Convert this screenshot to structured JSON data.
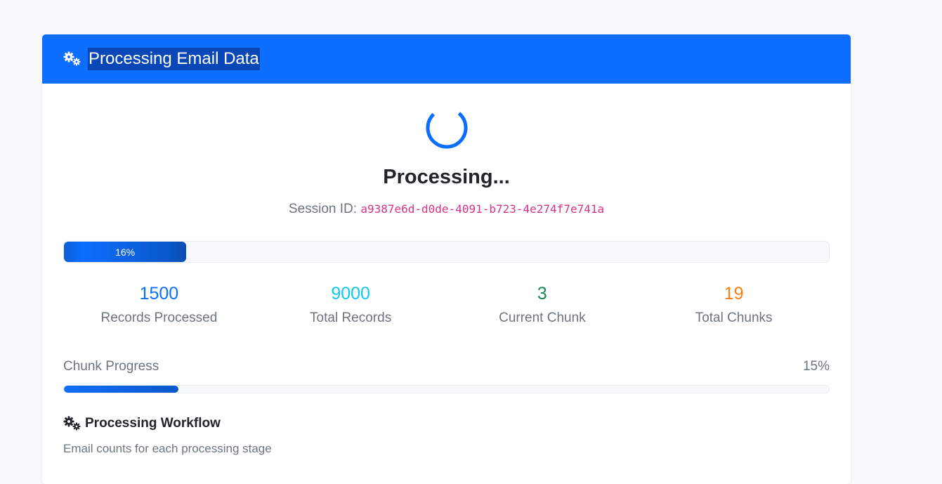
{
  "header": {
    "title": "Processing Email Data",
    "icon": "gears-icon"
  },
  "status": {
    "title": "Processing...",
    "session_label": "Session ID:",
    "session_id": "a9387e6d-d0de-4091-b723-4e274f7e741a"
  },
  "overall_progress": {
    "percent": 16,
    "label": "16%"
  },
  "stats": [
    {
      "value": "1500",
      "label": "Records Processed",
      "color": "#0d6efd"
    },
    {
      "value": "9000",
      "label": "Total Records",
      "color": "#0dcaf0"
    },
    {
      "value": "3",
      "label": "Current Chunk",
      "color": "#198754"
    },
    {
      "value": "19",
      "label": "Total Chunks",
      "color": "#fd7e14"
    }
  ],
  "chunk_progress": {
    "label": "Chunk Progress",
    "percent": 15,
    "percent_label": "15%"
  },
  "workflow": {
    "title": "Processing Workflow",
    "description": "Email counts for each processing stage",
    "icon": "gears-icon"
  },
  "colors": {
    "primary": "#0d6efd",
    "info": "#0dcaf0",
    "success": "#198754",
    "warning": "#fd7e14",
    "code": "#d63384"
  }
}
